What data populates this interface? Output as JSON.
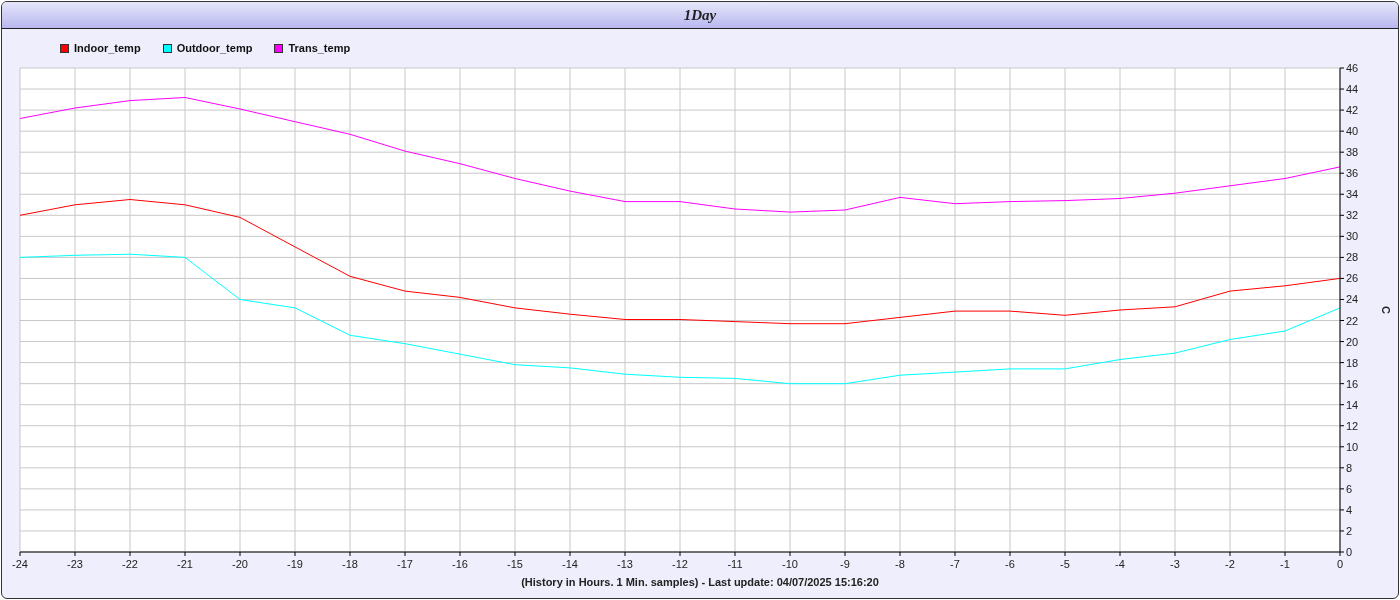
{
  "window": {
    "title": "1Day"
  },
  "chart": {
    "chart_data": {
      "type": "line",
      "grid": true,
      "xlabel": "(History in Hours. 1 Min. samples) - Last update: 04/07/2025 15:16:20",
      "ylabel": "C",
      "x": [
        -24,
        -23,
        -22,
        -21,
        -20,
        -19,
        -18,
        -17,
        -16,
        -15,
        -14,
        -13,
        -12,
        -11,
        -10,
        -9,
        -8,
        -7,
        -6,
        -5,
        -4,
        -3,
        -2,
        -1,
        0
      ],
      "series": [
        {
          "name": "Indoor_temp",
          "color": "#ff0000",
          "values": [
            32,
            33,
            33.5,
            33,
            31.8,
            29,
            26.2,
            24.8,
            24.2,
            23.2,
            22.6,
            22.1,
            22.1,
            21.9,
            21.7,
            21.7,
            22.3,
            22.9,
            22.9,
            22.5,
            23,
            23.3,
            24.8,
            25.3,
            26
          ]
        },
        {
          "name": "Outdoor_temp",
          "color": "#00ffff",
          "values": [
            28,
            28.2,
            28.3,
            28,
            24,
            23.2,
            20.6,
            19.8,
            18.8,
            17.8,
            17.5,
            16.9,
            16.6,
            16.5,
            16,
            16,
            16.8,
            17.1,
            17.4,
            17.4,
            18.3,
            18.9,
            20.2,
            21,
            23.2
          ]
        },
        {
          "name": "Trans_temp",
          "color": "#ff00ff",
          "values": [
            41.2,
            42.2,
            42.9,
            43.2,
            42.1,
            40.9,
            39.7,
            38.1,
            36.9,
            35.5,
            34.3,
            33.3,
            33.3,
            32.6,
            32.3,
            32.5,
            33.7,
            33.1,
            33.3,
            33.4,
            33.6,
            34.1,
            34.8,
            35.5,
            36.6
          ]
        }
      ],
      "xlim": [
        -24,
        0
      ],
      "ylim": [
        0,
        46
      ],
      "xticks": [
        -24,
        -23,
        -22,
        -21,
        -20,
        -19,
        -18,
        -17,
        -16,
        -15,
        -14,
        -13,
        -12,
        -11,
        -10,
        -9,
        -8,
        -7,
        -6,
        -5,
        -4,
        -3,
        -2,
        -1,
        0
      ],
      "yticks": [
        0,
        2,
        4,
        6,
        8,
        10,
        12,
        14,
        16,
        18,
        20,
        22,
        24,
        26,
        28,
        30,
        32,
        34,
        36,
        38,
        40,
        42,
        44,
        46
      ]
    }
  }
}
